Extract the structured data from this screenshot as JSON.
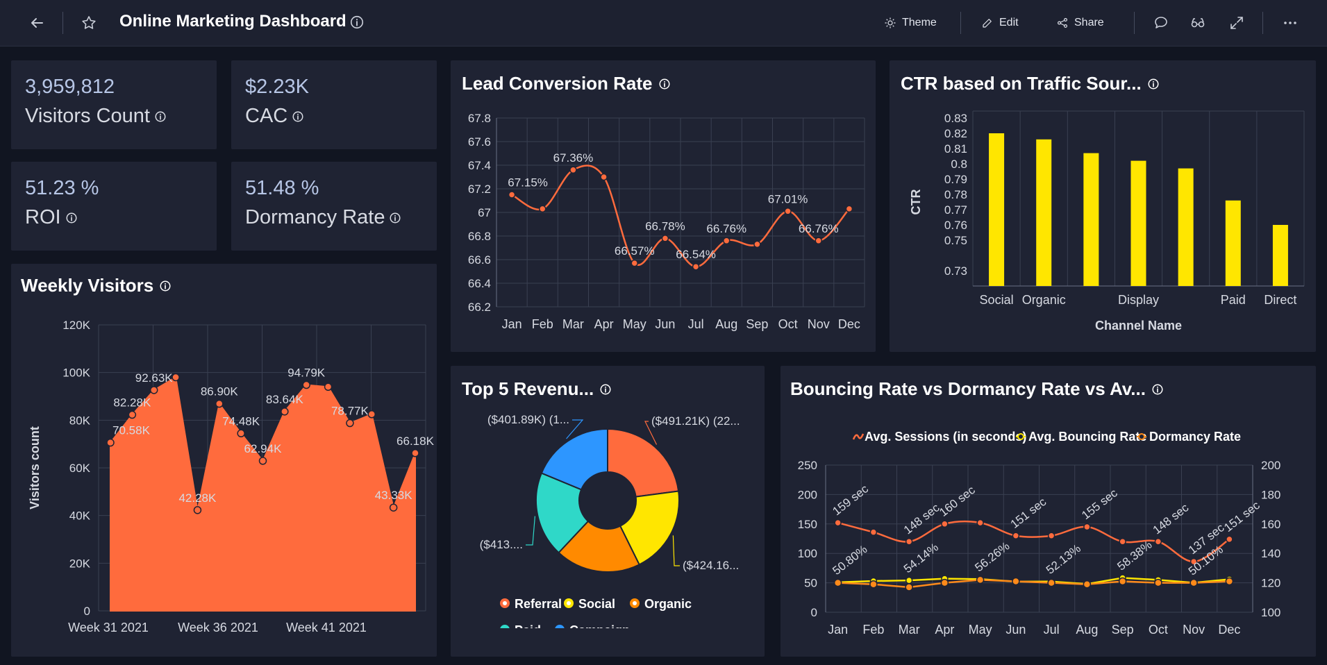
{
  "header": {
    "title": "Online Marketing Dashboard",
    "theme_label": "Theme",
    "edit_label": "Edit",
    "share_label": "Share"
  },
  "kpis": [
    {
      "value": "3,959,812",
      "label": "Visitors Count"
    },
    {
      "value": "$2.23K",
      "label": "CAC"
    },
    {
      "value": "51.23 %",
      "label": "ROI"
    },
    {
      "value": "51.48 %",
      "label": "Dormancy Rate"
    }
  ],
  "colors": {
    "orange": "#ff6b3d",
    "yellow": "#ffe600",
    "panel": "#1f2333"
  },
  "charts": {
    "lead": {
      "title": "Lead Conversion Rate",
      "chart_data": {
        "type": "line",
        "categories": [
          "Jan",
          "Feb",
          "Mar",
          "Apr",
          "May",
          "Jun",
          "Jul",
          "Aug",
          "Sep",
          "Oct",
          "Nov",
          "Dec"
        ],
        "values": [
          67.15,
          67.03,
          67.36,
          67.3,
          66.57,
          66.78,
          66.54,
          66.76,
          66.73,
          67.01,
          66.76,
          67.03
        ],
        "data_labels": [
          "67.15%",
          "",
          "67.36%",
          "",
          "66.57%",
          "66.78%",
          "66.54%",
          "66.76%",
          "",
          "67.01%",
          "66.76%",
          ""
        ],
        "yticks": [
          "67.8",
          "67.6",
          "67.4",
          "67.2",
          "67",
          "66.8",
          "66.6",
          "66.4",
          "66.2"
        ],
        "ylim": [
          66.2,
          67.8
        ]
      }
    },
    "ctr": {
      "title": "CTR based on Traffic Sour...",
      "chart_data": {
        "type": "bar",
        "categories": [
          "Social",
          "Organic",
          "",
          "Display",
          "",
          "Paid",
          "Direct"
        ],
        "values": [
          0.82,
          0.816,
          0.807,
          0.802,
          0.797,
          0.776,
          0.76
        ],
        "yticks": [
          "0.83",
          "0.82",
          "0.81",
          "0.8",
          "0.79",
          "0.78",
          "0.77",
          "0.76",
          "0.75",
          "0.73"
        ],
        "ylabel": "CTR",
        "xlabel": "Channel Name",
        "ylim": [
          0.72,
          0.83
        ]
      }
    },
    "weekly": {
      "title": "Weekly Visitors",
      "chart_data": {
        "type": "area",
        "values": [
          70580,
          82280,
          92630,
          98000,
          42280,
          86900,
          74480,
          62940,
          83640,
          94790,
          94000,
          78770,
          82500,
          43330,
          66180
        ],
        "data_labels": [
          "70.58K",
          "82.28K",
          "92.63K",
          "",
          "42.28K",
          "86.90K",
          "74.48K",
          "62.94K",
          "83.64K",
          "94.79K",
          "",
          "78.77K",
          "",
          "43.33K",
          "66.18K"
        ],
        "yticks": [
          "120K",
          "100K",
          "80K",
          "60K",
          "40K",
          "20K",
          "0"
        ],
        "xticks": [
          "Week 31 2021",
          "Week 36 2021",
          "Week 41 2021"
        ],
        "ylabel": "Visitors count",
        "ylim": [
          0,
          120000
        ]
      }
    },
    "revenue": {
      "title": "Top 5 Revenu...",
      "chart_data": {
        "type": "pie",
        "slices": [
          {
            "name": "Referral",
            "value": 491.21,
            "label": "($491.21K) (22...",
            "color": "#ff6b3d"
          },
          {
            "name": "Social",
            "value": 424.16,
            "label": "($424.16...",
            "color": "#ffe600"
          },
          {
            "name": "Organic",
            "value": 413.5,
            "label": "",
            "color": "#ff8a00"
          },
          {
            "name": "Paid",
            "value": 413.0,
            "label": "($413....",
            "color": "#2fd8c8"
          },
          {
            "name": "Campaign",
            "value": 401.89,
            "label": "($401.89K) (1...",
            "color": "#2d96ff"
          }
        ],
        "legend": [
          "Referral",
          "Social",
          "Organic",
          "Paid",
          "Campaign"
        ]
      }
    },
    "bounce": {
      "title": "Bouncing Rate vs Dormancy Rate vs Av...",
      "chart_data": {
        "type": "line",
        "categories": [
          "Jan",
          "Feb",
          "Mar",
          "Apr",
          "May",
          "Jun",
          "Jul",
          "Aug",
          "Sep",
          "Oct",
          "Nov",
          "Dec"
        ],
        "series": [
          {
            "name": "Avg. Sessions (in seconds)",
            "axis": "left",
            "values": [
              152,
              136,
              120,
              150,
              152,
              130,
              130,
              145,
              120,
              120,
              86,
              124
            ],
            "labels": [
              "159 sec",
              "",
              "148 sec",
              "160 sec",
              "",
              "151 sec",
              "",
              "155 sec",
              "",
              "148 sec",
              "137 sec",
              "151 sec"
            ]
          },
          {
            "name": "Avg. Bouncing Rate",
            "axis": "left",
            "values": [
              50.8,
              53,
              54.14,
              57,
              56.26,
              52,
              52.13,
              48,
              58.38,
              55,
              50.1,
              56
            ],
            "labels": [
              "50.80%",
              "",
              "54.14%",
              "",
              "56.26%",
              "",
              "52.13%",
              "",
              "58.38%",
              "",
              "50.10%",
              ""
            ]
          },
          {
            "name": "Dormancy Rate",
            "axis": "right",
            "values": [
              120,
              119,
              117,
              120,
              122,
              121,
              120,
              119,
              121,
              120,
              120,
              121
            ],
            "labels": []
          }
        ],
        "yticks_left": [
          "250",
          "200",
          "150",
          "100",
          "50",
          "0"
        ],
        "yticks_right": [
          "200",
          "180",
          "160",
          "140",
          "120",
          "100"
        ],
        "ylim_left": [
          0,
          250
        ],
        "ylim_right": [
          100,
          200
        ]
      }
    }
  }
}
